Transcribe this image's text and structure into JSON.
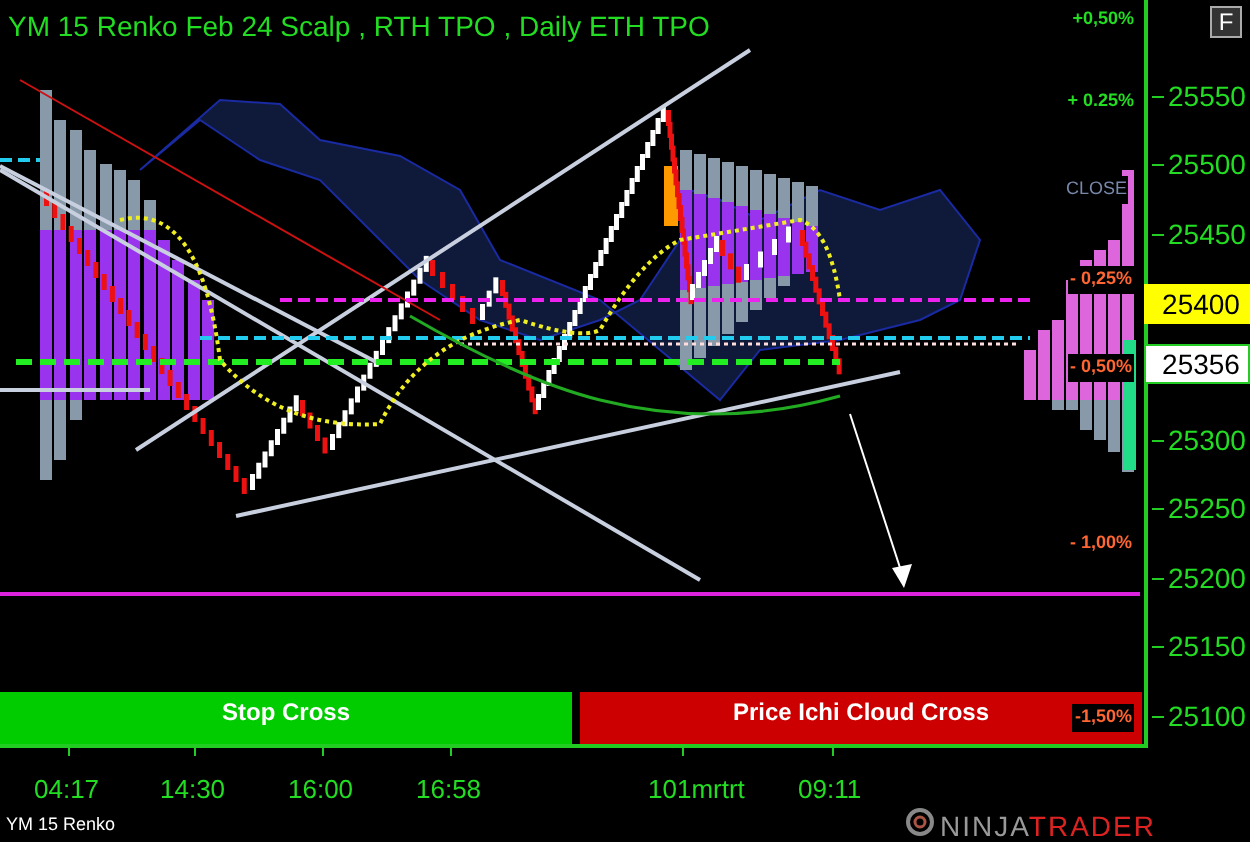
{
  "chart": {
    "title": "YM 15 Renko Feb 24 Scalp , RTH TPO , Daily ETH TPO",
    "flag_button": "F",
    "close_label": "CLOSE",
    "percent_labels": [
      {
        "text": "+0,50%",
        "kind": "up"
      },
      {
        "text": "+ 0.25%",
        "kind": "up"
      },
      {
        "text": "- 0,25%",
        "kind": "down"
      },
      {
        "text": "- 0,50%",
        "kind": "down"
      },
      {
        "text": "- 1,00%",
        "kind": "down"
      },
      {
        "text": "-1,50%",
        "kind": "down"
      }
    ],
    "price_labels": [
      "25550",
      "25500",
      "25450",
      "25300",
      "25250",
      "25200",
      "25150",
      "25100"
    ],
    "price_markers": [
      {
        "text": "25400",
        "kind": "level"
      },
      {
        "text": "25356",
        "kind": "last"
      }
    ],
    "signals": [
      {
        "text": "Stop Cross",
        "color": "#00cc00"
      },
      {
        "text": "Price Ichi Cloud Cross",
        "color": "#cc0000"
      }
    ],
    "time_labels": [
      "04:17",
      "14:30",
      "16:00",
      "16:58",
      "101mrtrt",
      "09:11"
    ],
    "instrument": "YM 15 Renko",
    "logo": {
      "part_1": "NINJA",
      "part_2": "TRADER"
    }
  }
}
